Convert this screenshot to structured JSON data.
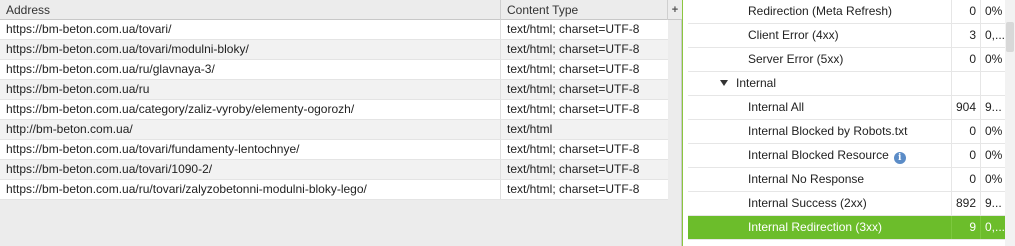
{
  "table": {
    "columns": {
      "address": "Address",
      "content_type": "Content Type",
      "add_column": "+"
    },
    "rows": [
      {
        "address": "https://bm-beton.com.ua/tovari/",
        "content_type": "text/html; charset=UTF-8"
      },
      {
        "address": "https://bm-beton.com.ua/tovari/modulni-bloky/",
        "content_type": "text/html; charset=UTF-8"
      },
      {
        "address": "https://bm-beton.com.ua/ru/glavnaya-3/",
        "content_type": "text/html; charset=UTF-8"
      },
      {
        "address": "https://bm-beton.com.ua/ru",
        "content_type": "text/html; charset=UTF-8"
      },
      {
        "address": "https://bm-beton.com.ua/category/zaliz-vyroby/elementy-ogorozh/",
        "content_type": "text/html; charset=UTF-8"
      },
      {
        "address": "http://bm-beton.com.ua/",
        "content_type": "text/html"
      },
      {
        "address": "https://bm-beton.com.ua/tovari/fundamenty-lentochnye/",
        "content_type": "text/html; charset=UTF-8"
      },
      {
        "address": "https://bm-beton.com.ua/tovari/1090-2/",
        "content_type": "text/html; charset=UTF-8"
      },
      {
        "address": "https://bm-beton.com.ua/ru/tovari/zalyzobetonni-modulni-bloky-lego/",
        "content_type": "text/html; charset=UTF-8"
      }
    ]
  },
  "tree": {
    "items": [
      {
        "label": "Redirection (Meta Refresh)",
        "count": "0",
        "percent": "0%"
      },
      {
        "label": "Client Error (4xx)",
        "count": "3",
        "percent": "0,..."
      },
      {
        "label": "Server Error (5xx)",
        "count": "0",
        "percent": "0%"
      },
      {
        "label": "Internal",
        "count": "",
        "percent": ""
      },
      {
        "label": "Internal All",
        "count": "904",
        "percent": "9..."
      },
      {
        "label": "Internal Blocked by Robots.txt",
        "count": "0",
        "percent": "0%"
      },
      {
        "label": "Internal Blocked Resource",
        "count": "0",
        "percent": "0%"
      },
      {
        "label": "Internal No Response",
        "count": "0",
        "percent": "0%"
      },
      {
        "label": "Internal Success (2xx)",
        "count": "892",
        "percent": "9..."
      },
      {
        "label": "Internal Redirection (3xx)",
        "count": "9",
        "percent": "0,..."
      }
    ]
  },
  "colors": {
    "selected_row": "#6cbd2b",
    "info_icon": "#5b8cc7"
  },
  "icons": {
    "expand": "caret-down-icon",
    "info": "info-icon"
  },
  "info_glyph": "i"
}
